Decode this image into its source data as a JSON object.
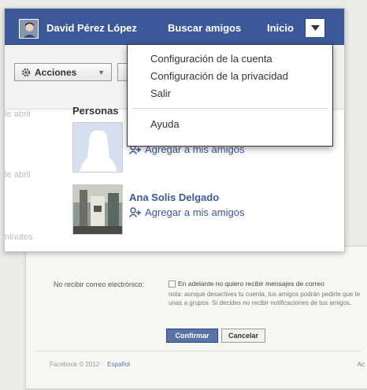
{
  "header": {
    "user_name": "David Pérez López",
    "find_friends": "Buscar amigos",
    "home": "Inicio"
  },
  "dropdown": {
    "items": [
      {
        "label": "Configuración de la cuenta"
      },
      {
        "label": "Configuración de la privacidad"
      },
      {
        "label": "Salir"
      },
      {
        "label": "Ayuda"
      }
    ]
  },
  "toolbar": {
    "actions_label": "Acciones"
  },
  "left_column": {
    "times": [
      "le abril",
      "le abril",
      "ninutos"
    ]
  },
  "people": {
    "section_title": "Personas",
    "items": [
      {
        "name": "",
        "add_label": "Agregar a mis amigos"
      },
      {
        "name": "Ana Solis Delgado",
        "add_label": "Agregar a mis amigos"
      }
    ]
  },
  "background_page": {
    "label": "No recibir correo electrónico:",
    "checkbox_text": "En adelante no quiero recibir mensajes de correo",
    "note": "nota: aunque desactives tu cuenta, tus amigos podrán pedirte que te unas a grupos. Si decides no recibir notificaciones de tus amigos.",
    "confirm_label": "Confirmar",
    "cancel_label": "Cancelar",
    "footer_left": "Facebook © 2012 ·",
    "footer_lang": "Español",
    "footer_right": "Ac"
  },
  "colors": {
    "brand_blue": "#3b5998",
    "brand_dark": "#29447e",
    "link_blue": "#3b5998"
  },
  "icons": {
    "settings": "gear-icon",
    "dropdown": "chevron-down-icon",
    "add_friend": "add-friend-icon"
  }
}
